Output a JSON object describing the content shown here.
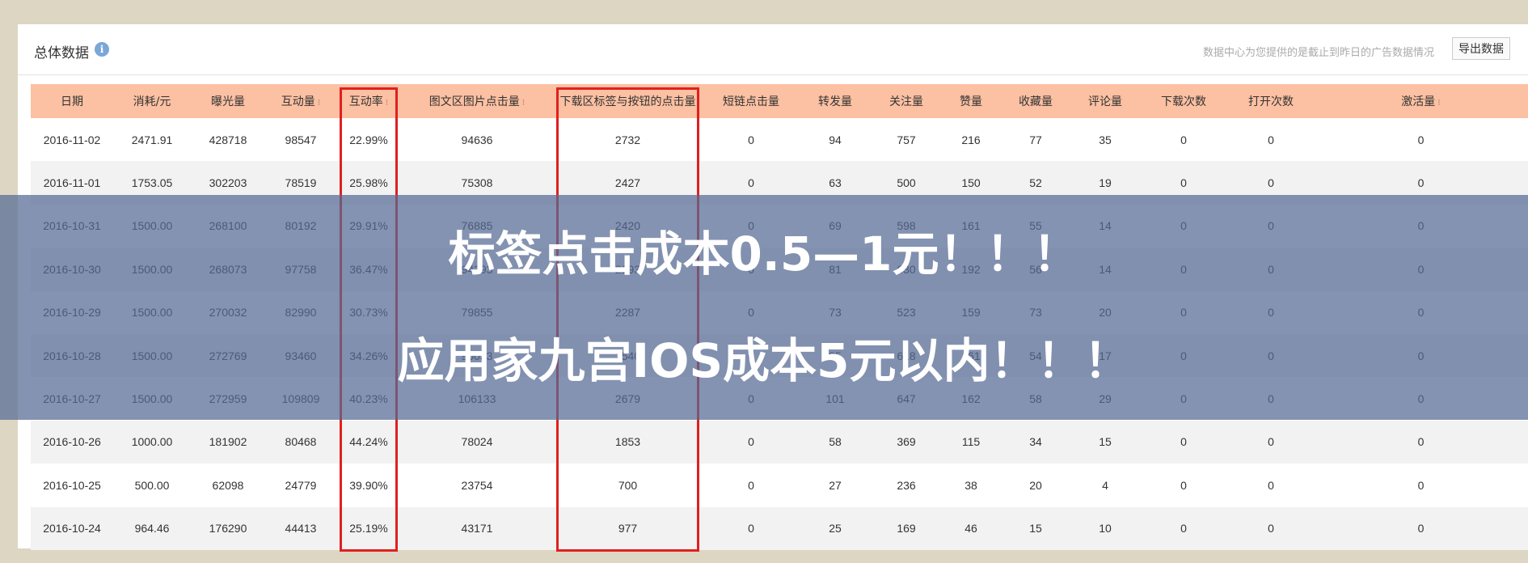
{
  "panel": {
    "title": "总体数据",
    "info_icon": "i",
    "note": "数据中心为您提供的是截止到昨日的广告数据情况",
    "export_label": "导出数据"
  },
  "table": {
    "columns": [
      {
        "label": "日期",
        "sortable": false
      },
      {
        "label": "消耗/元",
        "sortable": false
      },
      {
        "label": "曝光量",
        "sortable": false
      },
      {
        "label": "互动量",
        "sortable": true
      },
      {
        "label": "互动率",
        "sortable": true
      },
      {
        "label": "图文区图片点击量",
        "sortable": true
      },
      {
        "label": "下载区标签与按钮的点击量",
        "sortable": false
      },
      {
        "label": "短链点击量",
        "sortable": false
      },
      {
        "label": "转发量",
        "sortable": false
      },
      {
        "label": "关注量",
        "sortable": false
      },
      {
        "label": "赞量",
        "sortable": false
      },
      {
        "label": "收藏量",
        "sortable": false
      },
      {
        "label": "评论量",
        "sortable": false
      },
      {
        "label": "下载次数",
        "sortable": false
      },
      {
        "label": "打开次数",
        "sortable": false
      },
      {
        "label": "激活量",
        "sortable": true
      }
    ],
    "rows": [
      [
        "2016-11-02",
        "2471.91",
        "428718",
        "98547",
        "22.99%",
        "94636",
        "2732",
        "0",
        "94",
        "757",
        "216",
        "77",
        "35",
        "0",
        "0",
        "0"
      ],
      [
        "2016-11-01",
        "1753.05",
        "302203",
        "78519",
        "25.98%",
        "75308",
        "2427",
        "0",
        "63",
        "500",
        "150",
        "52",
        "19",
        "0",
        "0",
        "0"
      ],
      [
        "2016-10-31",
        "1500.00",
        "268100",
        "80192",
        "29.91%",
        "76885",
        "2420",
        "0",
        "69",
        "598",
        "161",
        "55",
        "14",
        "0",
        "0",
        "0"
      ],
      [
        "2016-10-30",
        "1500.00",
        "268073",
        "97758",
        "36.47%",
        "94293",
        "2293",
        "0",
        "81",
        "630",
        "192",
        "56",
        "14",
        "0",
        "0",
        "0"
      ],
      [
        "2016-10-29",
        "1500.00",
        "270032",
        "82990",
        "30.73%",
        "79855",
        "2287",
        "0",
        "73",
        "523",
        "159",
        "73",
        "20",
        "0",
        "0",
        "0"
      ],
      [
        "2016-10-28",
        "1500.00",
        "272769",
        "93460",
        "34.26%",
        "90033",
        "2540",
        "0",
        "85",
        "618",
        "161",
        "54",
        "17",
        "0",
        "0",
        "0"
      ],
      [
        "2016-10-27",
        "1500.00",
        "272959",
        "109809",
        "40.23%",
        "106133",
        "2679",
        "0",
        "101",
        "647",
        "162",
        "58",
        "29",
        "0",
        "0",
        "0"
      ],
      [
        "2016-10-26",
        "1000.00",
        "181902",
        "80468",
        "44.24%",
        "78024",
        "1853",
        "0",
        "58",
        "369",
        "115",
        "34",
        "15",
        "0",
        "0",
        "0"
      ],
      [
        "2016-10-25",
        "500.00",
        "62098",
        "24779",
        "39.90%",
        "23754",
        "700",
        "0",
        "27",
        "236",
        "38",
        "20",
        "4",
        "0",
        "0",
        "0"
      ],
      [
        "2016-10-24",
        "964.46",
        "176290",
        "44413",
        "25.19%",
        "43171",
        "977",
        "0",
        "25",
        "169",
        "46",
        "15",
        "10",
        "0",
        "0",
        "0"
      ]
    ]
  },
  "highlight": {
    "color": "#e0201f",
    "columns": [
      4,
      6
    ]
  },
  "overlay": {
    "line1": "标签点击成本0.5—1元！！！",
    "line2": "应用家九宫IOS成本5元以内！！！"
  }
}
